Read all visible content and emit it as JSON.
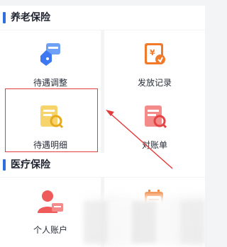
{
  "sections": [
    {
      "title": "养老保险"
    },
    {
      "title": "医疗保险"
    }
  ],
  "tiles": [
    {
      "label": "待遇调整",
      "icon": "hand-card-icon",
      "color": "#3d78f2"
    },
    {
      "label": "发放记录",
      "icon": "yuan-receipt-icon",
      "color": "#f07a2a"
    },
    {
      "label": "待遇明细",
      "icon": "doc-search-icon",
      "color": "#f0b92e"
    },
    {
      "label": "对账单",
      "icon": "statement-search-icon",
      "color": "#ef5a5a"
    },
    {
      "label": "个人账户",
      "icon": "user-card-icon",
      "color": "#ef5a5a"
    },
    {
      "label": "",
      "icon": "calendar-icon",
      "color": "#f07a2a"
    }
  ],
  "annotation": {
    "color": "#e23c3c"
  }
}
